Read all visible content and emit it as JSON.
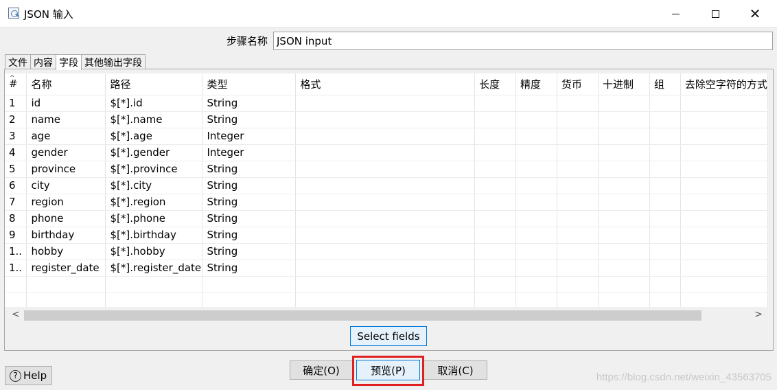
{
  "window": {
    "title": "JSON 输入",
    "icon": "json-input-step-icon"
  },
  "step": {
    "label": "步骤名称",
    "value": "JSON input"
  },
  "tabs": [
    {
      "label": "文件",
      "active": false
    },
    {
      "label": "内容",
      "active": false
    },
    {
      "label": "字段",
      "active": true
    },
    {
      "label": "其他输出字段",
      "active": false
    }
  ],
  "table": {
    "columns": [
      "#",
      "名称",
      "路径",
      "类型",
      "格式",
      "长度",
      "精度",
      "货币",
      "十进制",
      "组",
      "去除空字符的方式"
    ],
    "rows": [
      {
        "num": "1",
        "name": "id",
        "path": "$[*].id",
        "type": "String"
      },
      {
        "num": "2",
        "name": "name",
        "path": "$[*].name",
        "type": "String"
      },
      {
        "num": "3",
        "name": "age",
        "path": "$[*].age",
        "type": "Integer"
      },
      {
        "num": "4",
        "name": "gender",
        "path": "$[*].gender",
        "type": "Integer"
      },
      {
        "num": "5",
        "name": "province",
        "path": "$[*].province",
        "type": "String"
      },
      {
        "num": "6",
        "name": "city",
        "path": "$[*].city",
        "type": "String"
      },
      {
        "num": "7",
        "name": "region",
        "path": "$[*].region",
        "type": "String"
      },
      {
        "num": "8",
        "name": "phone",
        "path": "$[*].phone",
        "type": "String"
      },
      {
        "num": "9",
        "name": "birthday",
        "path": "$[*].birthday",
        "type": "String"
      },
      {
        "num": "1..",
        "name": "hobby",
        "path": "$[*].hobby",
        "type": "String"
      },
      {
        "num": "1..",
        "name": "register_date",
        "path": "$[*].register_date",
        "type": "String"
      }
    ]
  },
  "buttons": {
    "select_fields": "Select fields",
    "ok": "确定(O)",
    "preview": "预览(P)",
    "cancel": "取消(C)",
    "help": "Help"
  },
  "watermark": "https://blog.csdn.net/weixin_43563705",
  "colors": {
    "highlight": "#e02020",
    "focus_border": "#0078d7"
  }
}
